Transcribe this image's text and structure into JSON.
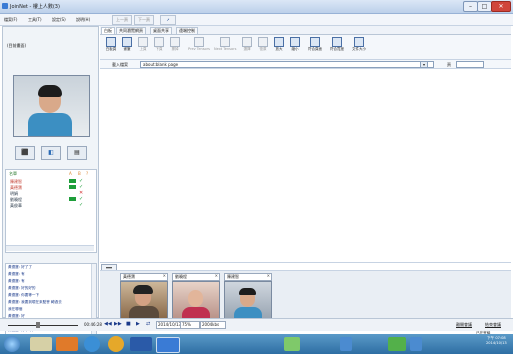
{
  "window": {
    "title": "JoinNet - 樓上人數(3)",
    "min": "–",
    "max": "□",
    "close": "✕"
  },
  "menubar": {
    "items": [
      "檔案(F)",
      "工具(T)",
      "設定(S)",
      "說明(H)"
    ]
  },
  "toolbar_top": {
    "items": [
      "上一頁",
      "下一頁",
      "➚"
    ]
  },
  "left": {
    "panel_title": "(目前畫面)",
    "controls": [
      "⬛",
      "◧",
      "▤"
    ],
    "members_header": [
      "名單",
      "A",
      "B",
      "?"
    ],
    "members": [
      {
        "name": "陳建智",
        "speaking": true,
        "status": "check"
      },
      {
        "name": "黃德寶",
        "speaking": true,
        "status": "check"
      },
      {
        "name": "明娟",
        "speaking": false,
        "status": "x"
      },
      {
        "name": "劉曉程",
        "speaking": true,
        "status": "check"
      },
      {
        "name": "黃俊華",
        "speaking": false,
        "status": "check"
      }
    ],
    "chat": [
      "黃德寶: 好了了",
      "黃德寶: 有",
      "黃德寶: 有",
      "黃德寶: 好的好的",
      "黃德寶: 你要等一下",
      "黃德寶: 我要到現在來點會 轉過去",
      "我在哪個",
      "黃德寶: 好",
      "黃德寶: 好",
      "黃德寶: 好 ( :) )",
      "黃德寶: 好好說話"
    ]
  },
  "tabs": [
    "白板",
    "共同瀏覽網頁",
    "桌面共享",
    "遠端控制"
  ],
  "ribbon": [
    {
      "label": "白板頁",
      "dim": false
    },
    {
      "label": "畫筆",
      "dim": false
    },
    {
      "label": "上頁",
      "dim": true
    },
    {
      "label": "下頁",
      "dim": true
    },
    {
      "label": "擦掉",
      "dim": true
    },
    {
      "label": "Prev Tensors",
      "dim": true
    },
    {
      "label": "Next Tensors",
      "dim": true
    },
    {
      "label": "選擇",
      "dim": true
    },
    {
      "label": "復原",
      "dim": true
    },
    {
      "label": "放大",
      "dim": false
    },
    {
      "label": "縮小",
      "dim": false
    },
    {
      "label": "符合頁面",
      "dim": false
    },
    {
      "label": "符合寬度",
      "dim": false
    },
    {
      "label": "文件大小",
      "dim": false
    }
  ],
  "urlbar": {
    "label": "載入檔案",
    "value": "about:blank page",
    "page_label": "頁"
  },
  "video_strip": {
    "toggle": "▾▾▾",
    "tiles": [
      {
        "name": "黃德寶"
      },
      {
        "name": "劉曉程"
      },
      {
        "name": "陳建智"
      }
    ]
  },
  "playbar": {
    "time": "00:46:28",
    "buttons": [
      "◀◀",
      "▶▶",
      "■",
      "▶",
      "⇄"
    ],
    "date": "2014/10/13",
    "zoom": "75%",
    "size": "2004kbs",
    "record": "離開會議",
    "logout": "結束會議",
    "status": "已在會議"
  },
  "taskbar": {
    "clock_time": "下午 07:08",
    "clock_date": "2014/10/13"
  },
  "colors": {
    "accent": "#3a7bd5",
    "speaking": "#1e9e3a",
    "error": "#d32f2f",
    "taskbar": "#2e6ea3"
  }
}
